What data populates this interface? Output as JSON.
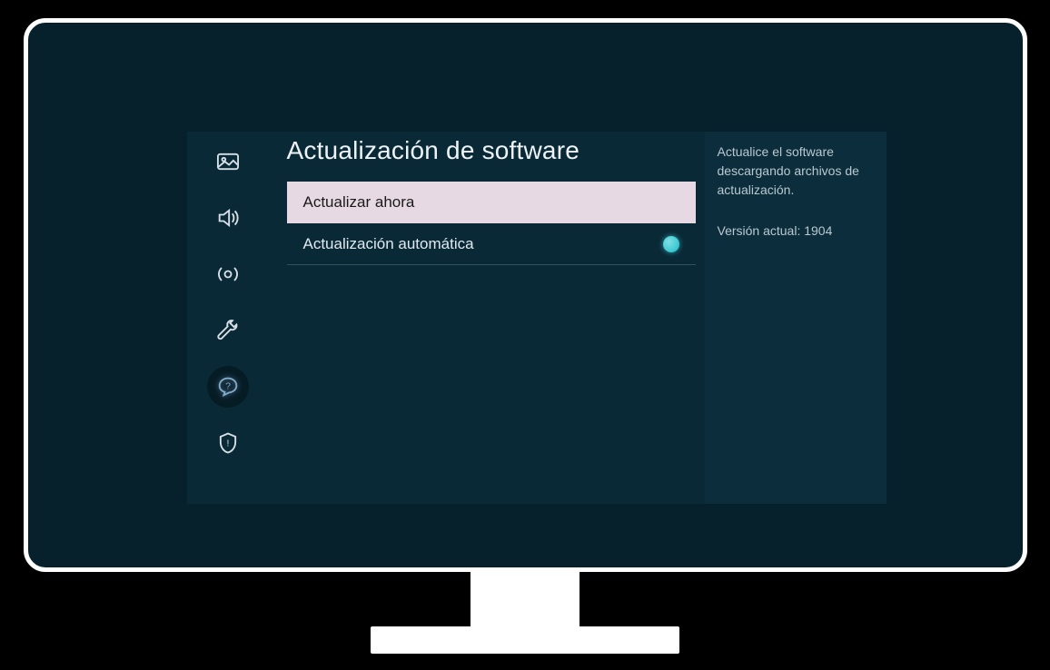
{
  "page_title": "Actualización de software",
  "sidebar": {
    "icons": [
      {
        "name": "picture-icon"
      },
      {
        "name": "sound-icon"
      },
      {
        "name": "broadcast-icon"
      },
      {
        "name": "wrench-icon"
      },
      {
        "name": "support-icon"
      },
      {
        "name": "shield-icon"
      }
    ],
    "selected_index": 4
  },
  "menu": {
    "update_now_label": "Actualizar ahora",
    "auto_update_label": "Actualización automática",
    "auto_update_on": true
  },
  "info": {
    "description": "Actualice el software descargando archivos de actualización.",
    "version_label": "Versión actual: 1904"
  }
}
